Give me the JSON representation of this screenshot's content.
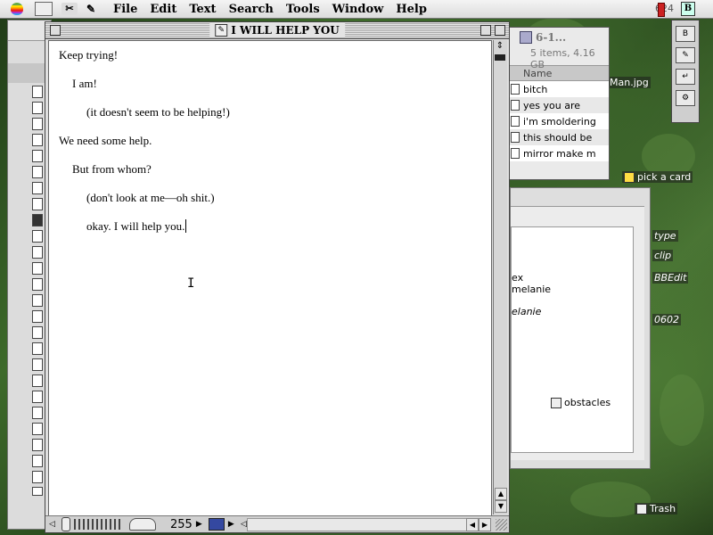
{
  "menubar": {
    "items": [
      "File",
      "Edit",
      "Text",
      "Search",
      "Tools",
      "Window",
      "Help"
    ],
    "clock": "624"
  },
  "document": {
    "title": "I WILL HELP YOU",
    "lines": [
      "Keep trying!",
      "I am!",
      "(it doesn't seem to be helping!)",
      "We need some help.",
      "But from whom?",
      "(don't look at me—oh shit.)",
      "okay. I will help you."
    ],
    "status_number": "255"
  },
  "finder": {
    "title": "6-1...",
    "info": "5 items, 4.16 GB",
    "column_header": "Name",
    "files": [
      "bitch",
      "yes you are",
      "i'm smoldering",
      "this should be",
      "mirror make m"
    ]
  },
  "lower_window": {
    "lines": [
      "ex",
      "melanie",
      "elanie"
    ],
    "item": "obstacles"
  },
  "desktop": {
    "labels": [
      "pick a card",
      "type",
      "clip",
      "BBEdit",
      "0602",
      "Trash",
      "Man.jpg"
    ]
  },
  "colors": {
    "desktop": "#2f5020",
    "window_bg": "#e0e0e0",
    "menubar": "#e8e8e8"
  }
}
